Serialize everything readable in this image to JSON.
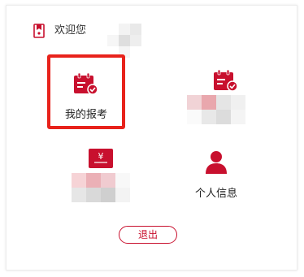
{
  "header": {
    "welcome_text": "欢迎您",
    "icon": "bookmark-icon"
  },
  "tiles": [
    {
      "label": "我的报考",
      "icon": "calendar-check-icon",
      "selected": true
    },
    {
      "label": "",
      "icon": "calendar-check-icon",
      "selected": false
    },
    {
      "label": "",
      "icon": "yuan-ticket-icon",
      "selected": false
    },
    {
      "label": "个人信息",
      "icon": "user-icon",
      "selected": false
    }
  ],
  "logout": {
    "label": "退出"
  },
  "colors": {
    "brand": "#c8102e",
    "selection": "#e8221b"
  }
}
